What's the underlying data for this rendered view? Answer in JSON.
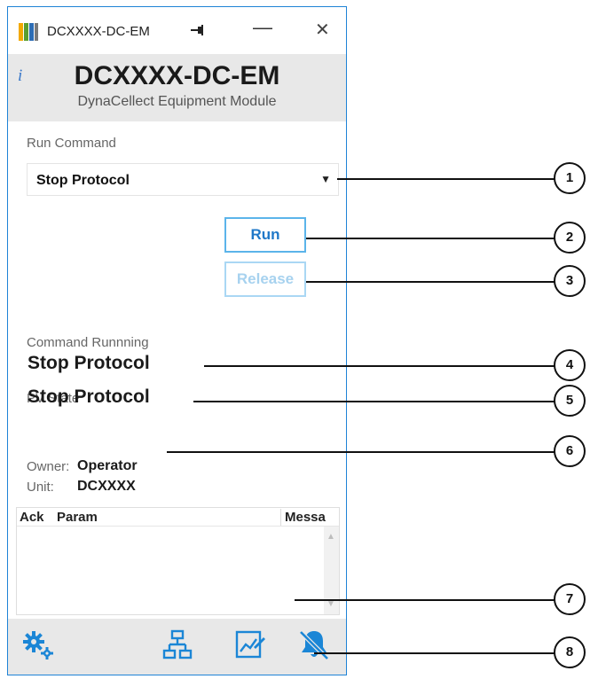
{
  "window": {
    "title": "DCXXXX-DC-EM",
    "pin_glyph": "→·",
    "minimize_glyph": "—",
    "close_glyph": "✕",
    "border_color": "#1f83d6"
  },
  "header": {
    "info_glyph": "i",
    "title": "DCXXXX-DC-EM",
    "subtitle": "DynaCellect Equipment Module",
    "background": "#e8e8e8"
  },
  "run_command": {
    "label": "Run Command",
    "selected": "Stop Protocol",
    "arrow": "▼"
  },
  "buttons": {
    "run": "Run",
    "release": "Release"
  },
  "status": {
    "command_running_label": "Command Runnning",
    "command_running_value": "Stop Protocol",
    "pv_state_label": "PV State",
    "pv_state_value": "Stop Protocol",
    "owner_label": "Owner:",
    "owner_value": "Operator",
    "unit_label": "Unit:",
    "unit_value": "DCXXXX"
  },
  "messages": {
    "columns": [
      "Ack",
      "Param",
      "Messa"
    ],
    "rows": [],
    "scroll_up": "▲",
    "scroll_down": "▼"
  },
  "footer": {
    "icons": [
      "settings-icon",
      "network-icon",
      "chart-edit-icon",
      "alarm-off-icon"
    ],
    "icon_color": "#1b86d6"
  },
  "callouts": [
    "1",
    "2",
    "3",
    "4",
    "5",
    "6",
    "7",
    "8"
  ]
}
